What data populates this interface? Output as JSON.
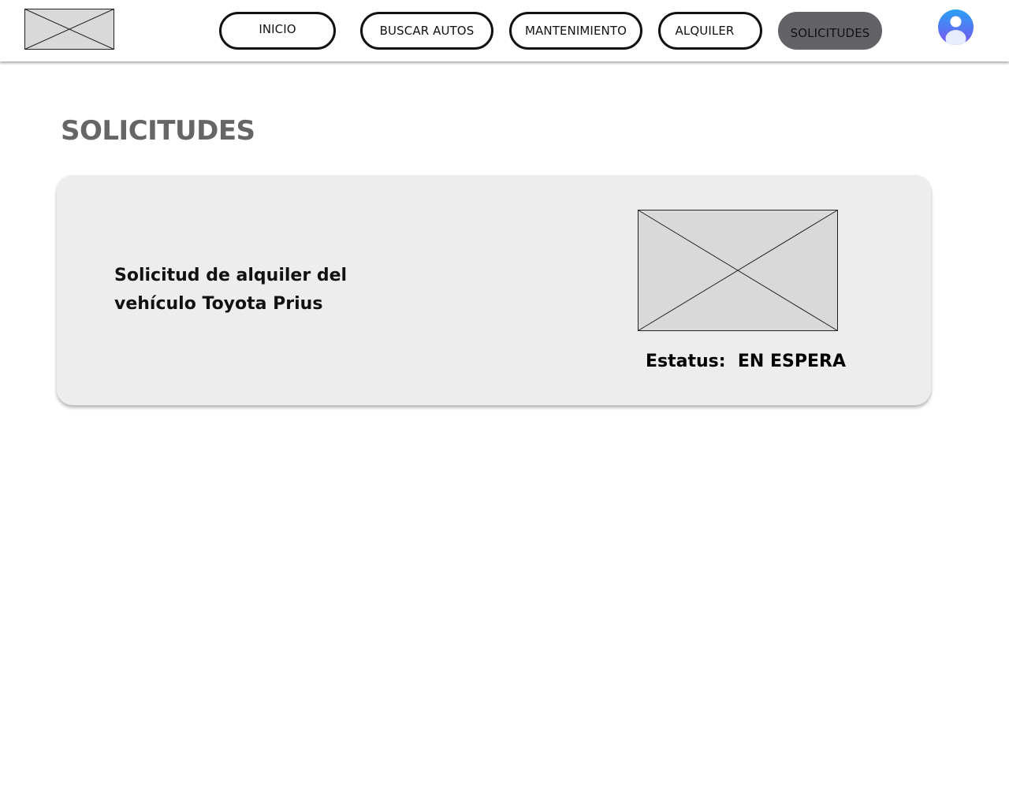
{
  "nav": {
    "items": [
      {
        "label": "INICIO",
        "active": false
      },
      {
        "label": "BUSCAR AUTOS",
        "active": false
      },
      {
        "label": "MANTENIMIENTO",
        "active": false
      },
      {
        "label": "ALQUILER",
        "active": false
      },
      {
        "label": "SOLICITUDES",
        "active": true
      }
    ]
  },
  "page": {
    "title": "SOLICITUDES"
  },
  "requests": [
    {
      "description": "Solicitud de alquiler del vehículo Toyota Prius",
      "status_label": "Estatus:",
      "status_value": "EN ESPERA"
    }
  ],
  "icons": {
    "logo": "image-placeholder-icon",
    "avatar": "user-avatar-icon",
    "vehicle_image": "image-placeholder-icon"
  },
  "colors": {
    "active_nav": "#636266",
    "title": "#666669",
    "card_bg": "#ededed",
    "placeholder": "#d9d9d9",
    "avatar_gradient_top": "#2aa0f5",
    "avatar_gradient_bottom": "#7a55f0"
  }
}
